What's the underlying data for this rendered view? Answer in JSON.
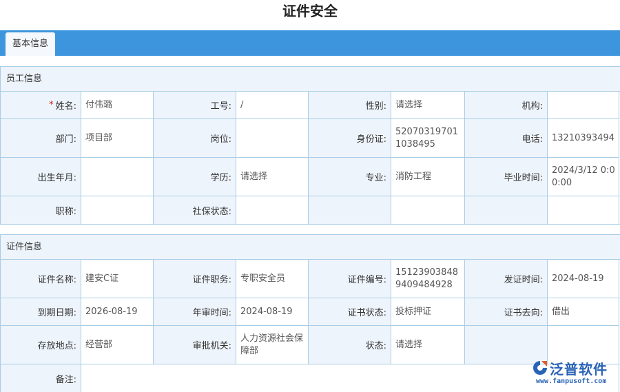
{
  "page": {
    "title": "证件安全"
  },
  "tabs": [
    {
      "label": "基本信息"
    }
  ],
  "employee_section": {
    "title": "员工信息",
    "rows": [
      [
        {
          "label": "姓名:",
          "required": true,
          "value": "付伟璐"
        },
        {
          "label": "工号:",
          "value": "/"
        },
        {
          "label": "性别:",
          "value": "请选择"
        },
        {
          "label": "机构:",
          "value": ""
        }
      ],
      [
        {
          "label": "部门:",
          "value": "项目部"
        },
        {
          "label": "岗位:",
          "value": ""
        },
        {
          "label": "身份证:",
          "value": "520703197011038495"
        },
        {
          "label": "电话:",
          "value": "13210393494"
        }
      ],
      [
        {
          "label": "出生年月:",
          "value": ""
        },
        {
          "label": "学历:",
          "value": "请选择"
        },
        {
          "label": "专业:",
          "value": "消防工程"
        },
        {
          "label": "毕业时间:",
          "value": "2024/3/12 0:00:00"
        }
      ],
      [
        {
          "label": "职称:",
          "value": ""
        },
        {
          "label": "社保状态:",
          "value": ""
        },
        {
          "label": "",
          "value": ""
        },
        {
          "label": "",
          "value": ""
        }
      ]
    ]
  },
  "cert_section": {
    "title": "证件信息",
    "rows": [
      [
        {
          "label": "证件名称:",
          "value": "建安C证"
        },
        {
          "label": "证件职务:",
          "value": "专职安全员"
        },
        {
          "label": "证件编号:",
          "value": "151239038489409484928"
        },
        {
          "label": "发证时间:",
          "value": "2024-08-19"
        }
      ],
      [
        {
          "label": "到期日期:",
          "value": "2026-08-19"
        },
        {
          "label": "年审时间:",
          "value": "2024-08-19"
        },
        {
          "label": "证书状态:",
          "value": "投标押证"
        },
        {
          "label": "证书去向:",
          "value": "借出"
        }
      ],
      [
        {
          "label": "存放地点:",
          "value": "经营部"
        },
        {
          "label": "审批机关:",
          "value": "人力资源社会保障部"
        },
        {
          "label": "状态:",
          "value": "请选择"
        },
        {
          "label": "",
          "value": ""
        }
      ],
      [
        {
          "label": "备注:",
          "value": ""
        }
      ]
    ]
  },
  "brand": {
    "name": "泛普软件",
    "url": "www.fanpusoft.com",
    "color": "#2a63b6"
  }
}
